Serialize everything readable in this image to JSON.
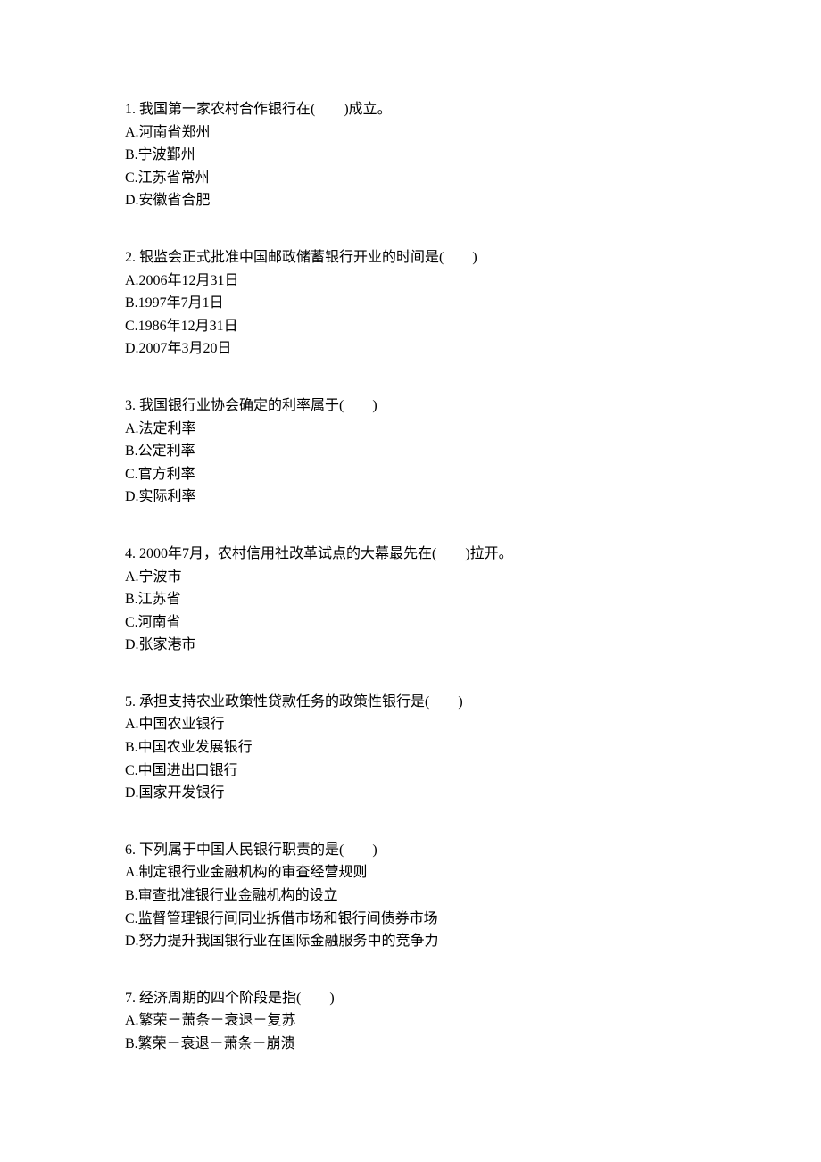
{
  "questions": [
    {
      "text": "1. 我国第一家农村合作银行在(　　)成立。",
      "options": [
        "A.河南省郑州",
        "B.宁波鄞州",
        "C.江苏省常州",
        "D.安徽省合肥"
      ]
    },
    {
      "text": "2. 银监会正式批准中国邮政储蓄银行开业的时间是(　　)",
      "options": [
        "A.2006年12月31日",
        "B.1997年7月1日",
        "C.1986年12月31日",
        "D.2007年3月20日"
      ]
    },
    {
      "text": "3. 我国银行业协会确定的利率属于(　　)",
      "options": [
        "A.法定利率",
        "B.公定利率",
        "C.官方利率",
        "D.实际利率"
      ]
    },
    {
      "text": "4. 2000年7月，农村信用社改革试点的大幕最先在(　　)拉开。",
      "options": [
        "A.宁波市",
        "B.江苏省",
        "C.河南省",
        "D.张家港市"
      ]
    },
    {
      "text": "5. 承担支持农业政策性贷款任务的政策性银行是(　　)",
      "options": [
        "A.中国农业银行",
        "B.中国农业发展银行",
        "C.中国进出口银行",
        "D.国家开发银行"
      ]
    },
    {
      "text": "6. 下列属于中国人民银行职责的是(　　)",
      "options": [
        "A.制定银行业金融机构的审查经营规则",
        "B.审查批准银行业金融机构的设立",
        "C.监督管理银行间同业拆借市场和银行间债券市场",
        "D.努力提升我国银行业在国际金融服务中的竞争力"
      ]
    },
    {
      "text": "7. 经济周期的四个阶段是指(　　)",
      "options": [
        "A.繁荣－萧条－衰退－复苏",
        "B.繁荣－衰退－萧条－崩溃"
      ]
    }
  ]
}
